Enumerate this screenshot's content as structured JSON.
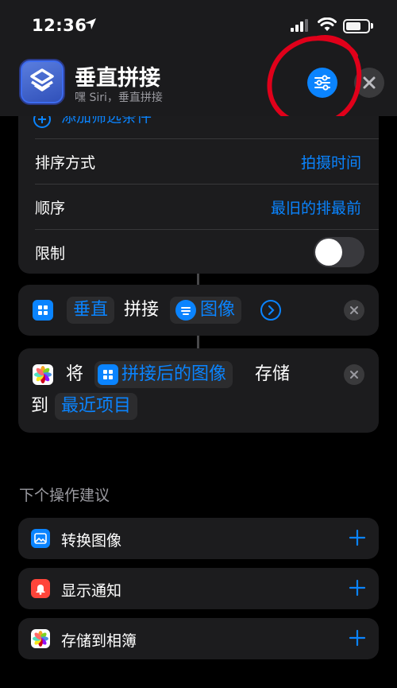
{
  "status_bar": {
    "time": "12:36"
  },
  "header": {
    "title": "垂直拼接",
    "subtitle": "嘿 Siri，垂直拼接"
  },
  "filter_card": {
    "partial_label": "添加筛选条件",
    "rows": [
      {
        "label": "排序方式",
        "value": "拍摄时间"
      },
      {
        "label": "顺序",
        "value": "最旧的排最前"
      }
    ],
    "limit": {
      "label": "限制",
      "enabled": false
    }
  },
  "combine_action": {
    "direction": "垂直",
    "verb": "拼接",
    "input": "图像"
  },
  "save_action": {
    "verb": "将",
    "input": "拼接后的图像",
    "verb2": "存储",
    "prep": "到",
    "album": "最近项目"
  },
  "suggestions": {
    "heading": "下个操作建议",
    "items": [
      {
        "label": "转换图像",
        "icon": "photo-icon",
        "color": "#0a84ff"
      },
      {
        "label": "显示通知",
        "icon": "bell-icon",
        "color": "#ff453a"
      },
      {
        "label": "存储到相簿",
        "icon": "photos-icon",
        "color": "#ffffff"
      }
    ]
  },
  "colors": {
    "accent": "#0a84ff",
    "annotation": "#e0001a"
  }
}
